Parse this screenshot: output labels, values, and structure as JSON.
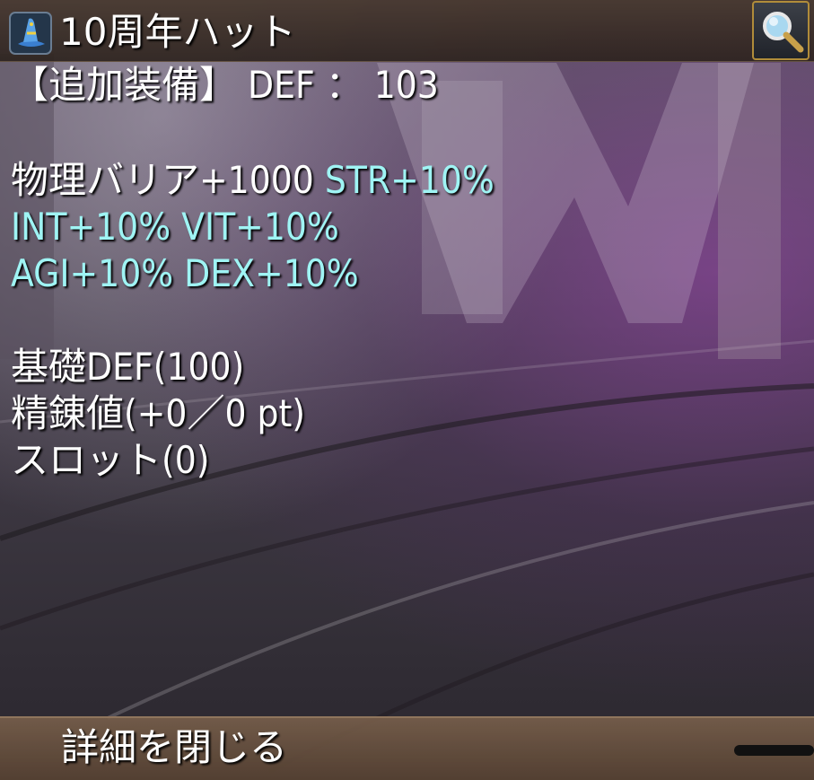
{
  "header": {
    "title": "10周年ハット",
    "icon": "wizard-hat-icon",
    "zoom_icon": "magnifier-icon"
  },
  "details": {
    "additional_equip": "【追加装備】 DEF ： 103",
    "effects_line1_white": "物理バリア+1000 ",
    "effects_line1_cyan": "STR+10%",
    "effects_line2": "INT+10% VIT+10%",
    "effects_line3": "AGI+10% DEX+10%",
    "base_def": "基礎DEF(100)",
    "refine": "精錬値(+0／0 pt)",
    "slot": "スロット(0)"
  },
  "footer": {
    "close_label": "詳細を閉じる"
  },
  "colors": {
    "stat_text": "#9ff4f4",
    "normal_text": "#ffffff",
    "button_border": "#b08c3a"
  }
}
